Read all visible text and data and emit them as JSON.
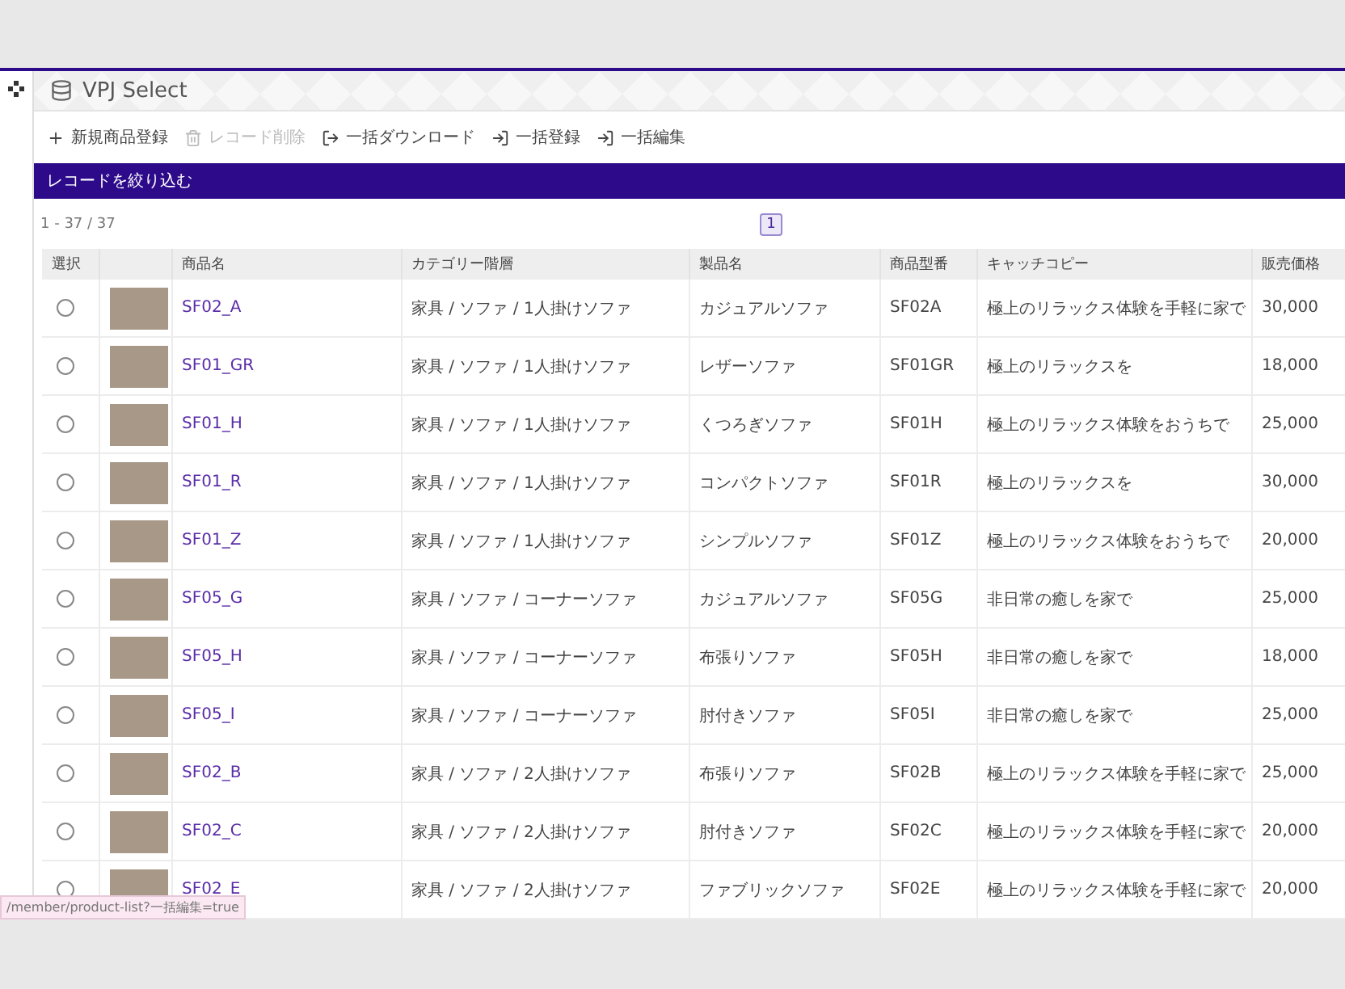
{
  "app": {
    "title": "VPJ Select"
  },
  "toolbar": [
    {
      "label": "新規商品登録",
      "kind": "add",
      "disabled": false
    },
    {
      "label": "レコード削除",
      "kind": "delete",
      "disabled": true
    },
    {
      "label": "一括ダウンロード",
      "kind": "download",
      "disabled": false
    },
    {
      "label": "一括登録",
      "kind": "import",
      "disabled": false
    },
    {
      "label": "一括編集",
      "kind": "import",
      "disabled": false
    }
  ],
  "filter_bar": {
    "label": "レコードを絞り込む"
  },
  "record_count": "1 - 37 / 37",
  "pagination": [
    {
      "label": "1",
      "selected": true
    }
  ],
  "table": {
    "columns": [
      "選択",
      "",
      "商品名",
      "カテゴリー階層",
      "製品名",
      "商品型番",
      "キャッチコピー",
      "販売価格"
    ],
    "rows": [
      {
        "selected": false,
        "name": "SF02_A",
        "category": "家具 / ソファ / 1人掛けソファ",
        "product": "カジュアルソファ",
        "code": "SF02A",
        "catch": "極上のリラックス体験を手軽に家で",
        "price": "30,000"
      },
      {
        "selected": false,
        "name": "SF01_GR",
        "category": "家具 / ソファ / 1人掛けソファ",
        "product": "レザーソファ",
        "code": "SF01GR",
        "catch": "極上のリラックスを",
        "price": "18,000"
      },
      {
        "selected": false,
        "name": "SF01_H",
        "category": "家具 / ソファ / 1人掛けソファ",
        "product": "くつろぎソファ",
        "code": "SF01H",
        "catch": "極上のリラックス体験をおうちで",
        "price": "25,000"
      },
      {
        "selected": false,
        "name": "SF01_R",
        "category": "家具 / ソファ / 1人掛けソファ",
        "product": "コンパクトソファ",
        "code": "SF01R",
        "catch": "極上のリラックスを",
        "price": "30,000"
      },
      {
        "selected": false,
        "name": "SF01_Z",
        "category": "家具 / ソファ / 1人掛けソファ",
        "product": "シンプルソファ",
        "code": "SF01Z",
        "catch": "極上のリラックス体験をおうちで",
        "price": "20,000"
      },
      {
        "selected": false,
        "name": "SF05_G",
        "category": "家具 / ソファ / コーナーソファ",
        "product": "カジュアルソファ",
        "code": "SF05G",
        "catch": "非日常の癒しを家で",
        "price": "25,000"
      },
      {
        "selected": false,
        "name": "SF05_H",
        "category": "家具 / ソファ / コーナーソファ",
        "product": "布張りソファ",
        "code": "SF05H",
        "catch": "非日常の癒しを家で",
        "price": "18,000"
      },
      {
        "selected": false,
        "name": "SF05_I",
        "category": "家具 / ソファ / コーナーソファ",
        "product": "肘付きソファ",
        "code": "SF05I",
        "catch": "非日常の癒しを家で",
        "price": "25,000"
      },
      {
        "selected": false,
        "name": "SF02_B",
        "category": "家具 / ソファ / 2人掛けソファ",
        "product": "布張りソファ",
        "code": "SF02B",
        "catch": "極上のリラックス体験を手軽に家で",
        "price": "25,000"
      },
      {
        "selected": false,
        "name": "SF02_C",
        "category": "家具 / ソファ / 2人掛けソファ",
        "product": "肘付きソファ",
        "code": "SF02C",
        "catch": "極上のリラックス体験を手軽に家で",
        "price": "20,000"
      },
      {
        "selected": false,
        "name": "SF02_E",
        "category": "家具 / ソファ / 2人掛けソファ",
        "product": "ファブリックソファ",
        "code": "SF02E",
        "catch": "極上のリラックス体験を手軽に家で",
        "price": "20,000"
      }
    ]
  },
  "status_url": "/member/product-list?一括編集=true"
}
